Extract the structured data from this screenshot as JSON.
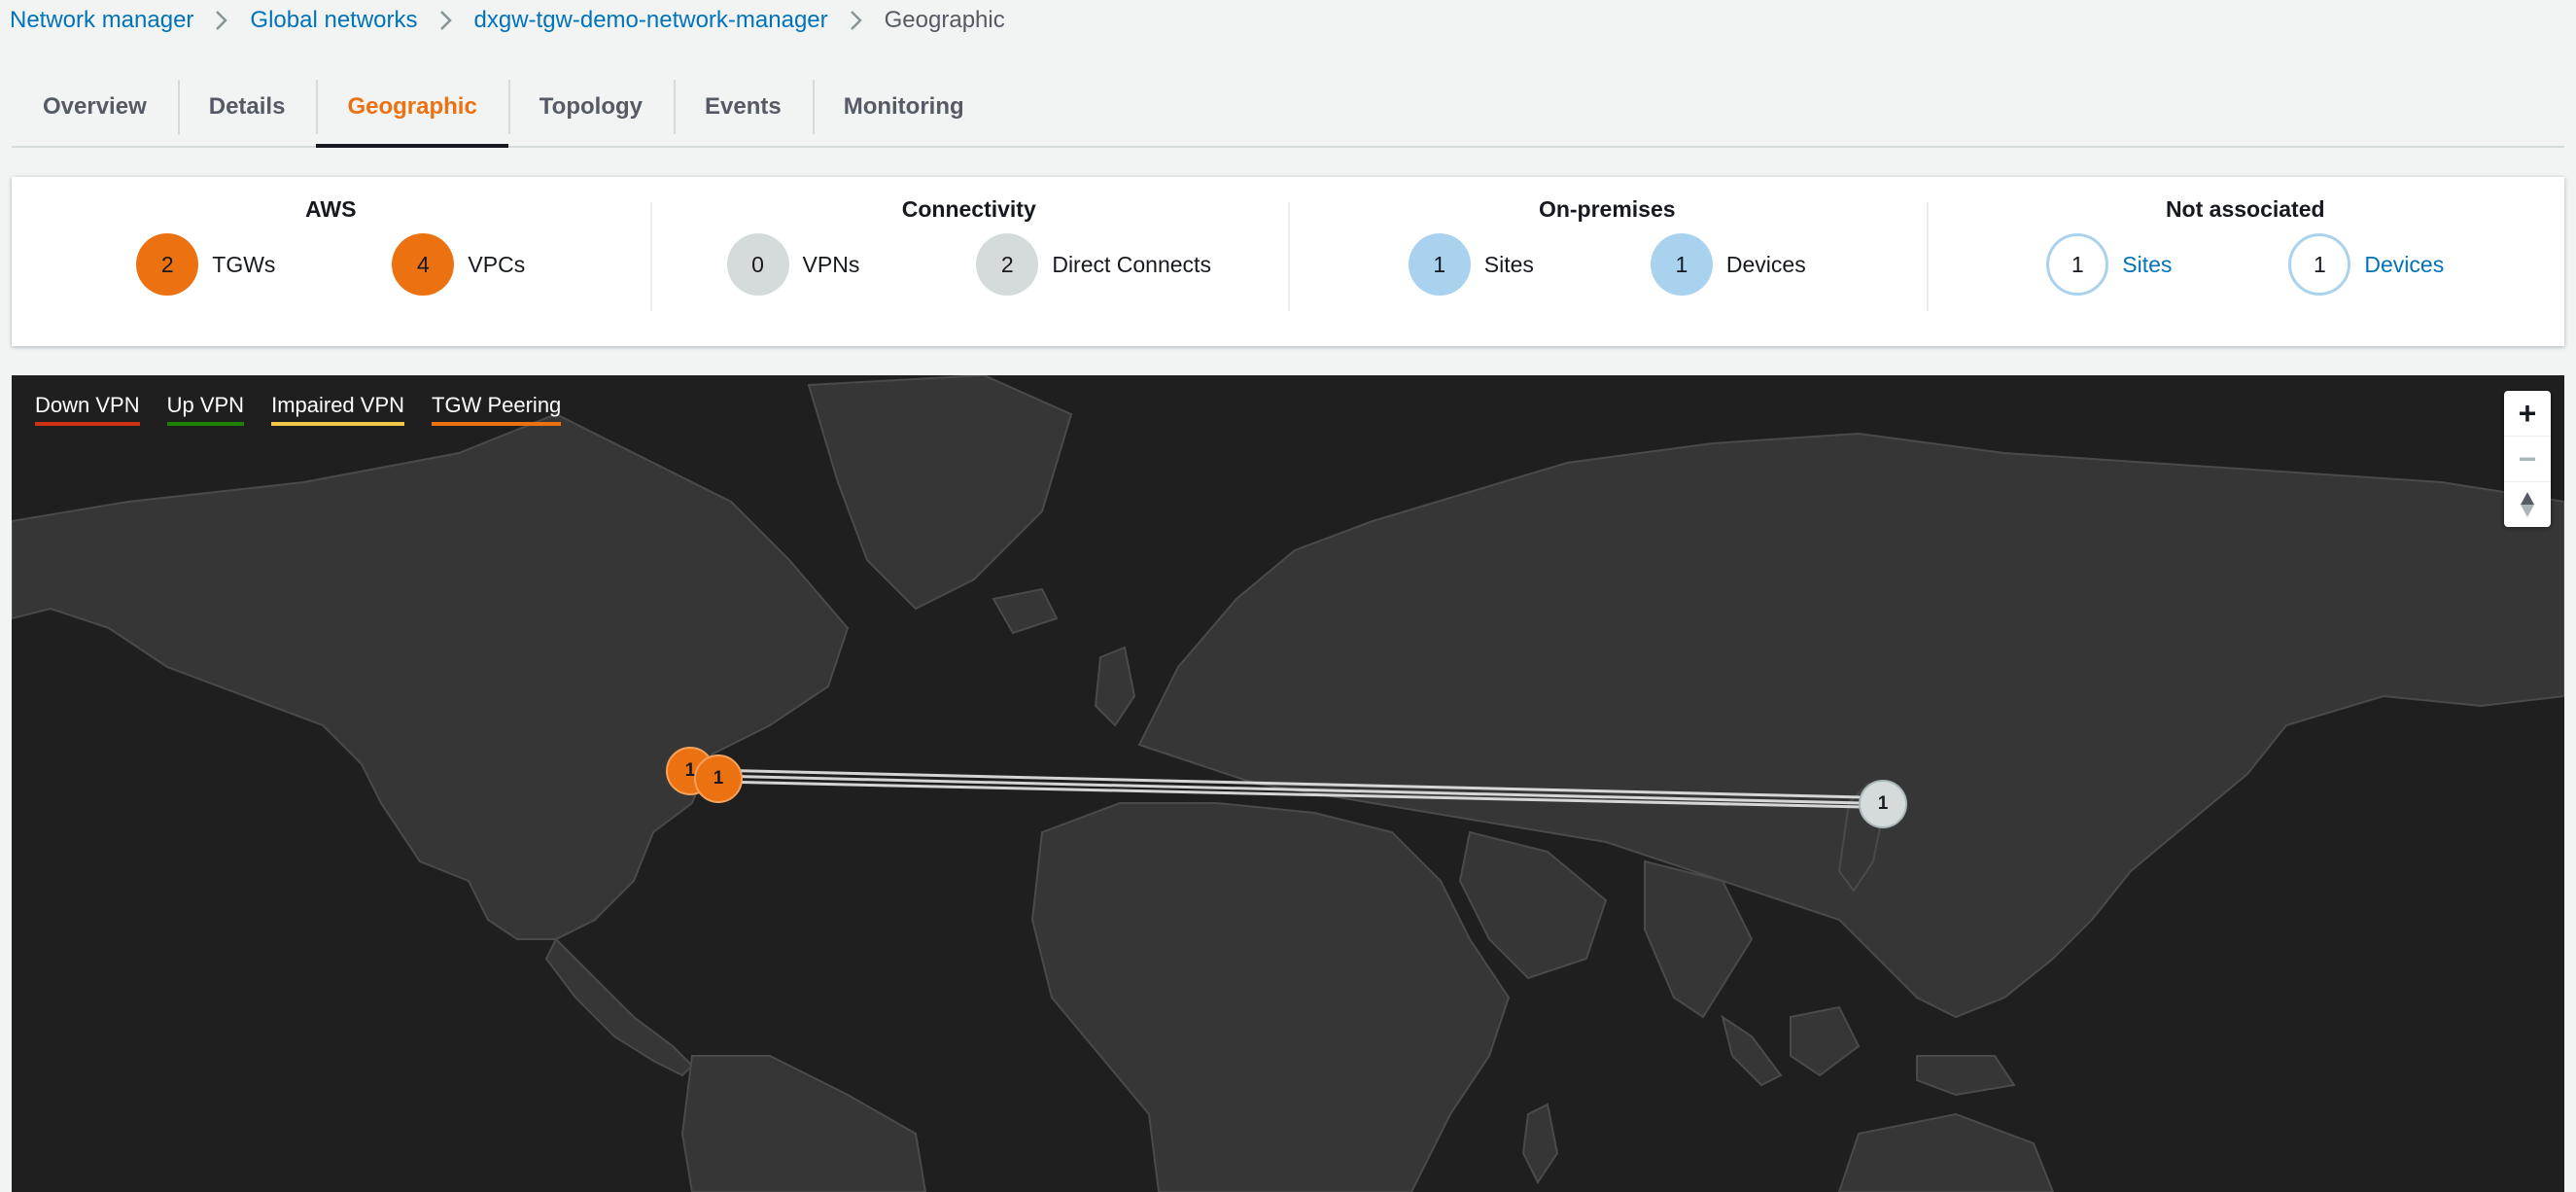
{
  "breadcrumb": {
    "items": [
      "Network manager",
      "Global networks",
      "dxgw-tgw-demo-network-manager"
    ],
    "current": "Geographic"
  },
  "tabs": [
    {
      "label": "Overview"
    },
    {
      "label": "Details"
    },
    {
      "label": "Geographic",
      "active": true
    },
    {
      "label": "Topology"
    },
    {
      "label": "Events"
    },
    {
      "label": "Monitoring"
    }
  ],
  "summary": {
    "aws": {
      "title": "AWS",
      "items": [
        {
          "count": "2",
          "label": "TGWs"
        },
        {
          "count": "4",
          "label": "VPCs"
        }
      ]
    },
    "connectivity": {
      "title": "Connectivity",
      "items": [
        {
          "count": "0",
          "label": "VPNs"
        },
        {
          "count": "2",
          "label": "Direct Connects"
        }
      ]
    },
    "onprem": {
      "title": "On-premises",
      "items": [
        {
          "count": "1",
          "label": "Sites"
        },
        {
          "count": "1",
          "label": "Devices"
        }
      ]
    },
    "notassoc": {
      "title": "Not associated",
      "items": [
        {
          "count": "1",
          "label": "Sites"
        },
        {
          "count": "1",
          "label": "Devices"
        }
      ]
    }
  },
  "legend": [
    {
      "label": "Down VPN",
      "color": "#d13212"
    },
    {
      "label": "Up VPN",
      "color": "#1d8102"
    },
    {
      "label": "Impaired VPN",
      "color": "#f2c744"
    },
    {
      "label": "TGW Peering",
      "color": "#ec7211"
    }
  ],
  "markers": [
    {
      "count": "1",
      "color": "orange"
    },
    {
      "count": "1",
      "color": "orange"
    },
    {
      "count": "1",
      "color": "gray"
    }
  ],
  "zoom": {
    "in": "+",
    "out": "−",
    "reset": "⮝"
  },
  "colors": {
    "accent": "#ec7211",
    "link": "#0073bb",
    "map_bg": "#1f1f1f",
    "land": "#363636"
  },
  "icons": {
    "separator": "chevron-right-icon",
    "zoom_in": "plus-icon",
    "zoom_out": "minus-icon",
    "reset": "compass-icon"
  }
}
